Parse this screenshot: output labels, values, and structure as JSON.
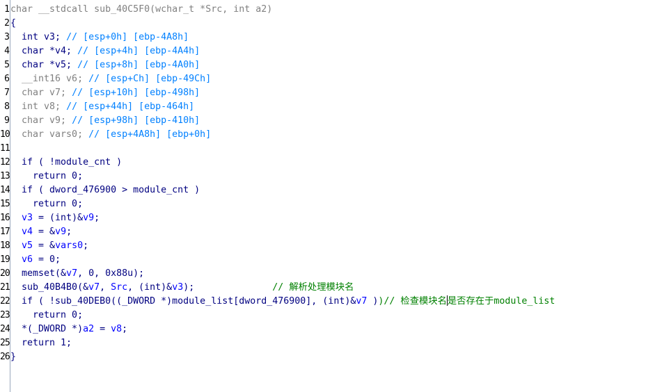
{
  "line_numbers": [
    "1",
    "2",
    "3",
    "4",
    "5",
    "6",
    "7",
    "8",
    "9",
    "10",
    "11",
    "12",
    "13",
    "14",
    "15",
    "16",
    "17",
    "18",
    "19",
    "20",
    "21",
    "22",
    "23",
    "24",
    "25",
    "26"
  ],
  "colors": {
    "background": "#ffffff",
    "gray_text": "#808080",
    "navy_text": "#000080",
    "blue_text": "#0000ff",
    "comment_text": "#0080ff",
    "green_comment": "#008000",
    "gutter_separator": "#9aa8bd"
  },
  "lines": [
    [
      {
        "t": "char __stdcall sub_40C5F0(wchar_t *Src, int a2)",
        "c": "gray"
      }
    ],
    [
      {
        "t": "{",
        "c": "navy"
      }
    ],
    [
      {
        "t": "  int v3; ",
        "c": "navy"
      },
      {
        "t": "// [esp+0h] [ebp-4A8h]",
        "c": "comment"
      }
    ],
    [
      {
        "t": "  char *v4; ",
        "c": "navy"
      },
      {
        "t": "// [esp+4h] [ebp-4A4h]",
        "c": "comment"
      }
    ],
    [
      {
        "t": "  char *v5; ",
        "c": "navy"
      },
      {
        "t": "// [esp+8h] [ebp-4A0h]",
        "c": "comment"
      }
    ],
    [
      {
        "t": "  __int16 v6; ",
        "c": "gray"
      },
      {
        "t": "// [esp+Ch] [ebp-49Ch]",
        "c": "comment"
      }
    ],
    [
      {
        "t": "  char v7; ",
        "c": "gray"
      },
      {
        "t": "// [esp+10h] [ebp-498h]",
        "c": "comment"
      }
    ],
    [
      {
        "t": "  int v8; ",
        "c": "gray"
      },
      {
        "t": "// [esp+44h] [ebp-464h]",
        "c": "comment"
      }
    ],
    [
      {
        "t": "  char v9; ",
        "c": "gray"
      },
      {
        "t": "// [esp+98h] [ebp-410h]",
        "c": "comment"
      }
    ],
    [
      {
        "t": "  char vars0; ",
        "c": "gray"
      },
      {
        "t": "// [esp+4A8h] [ebp+0h]",
        "c": "comment"
      }
    ],
    [
      {
        "t": "",
        "c": "navy"
      }
    ],
    [
      {
        "t": "  if ( !module_cnt )",
        "c": "navy"
      }
    ],
    [
      {
        "t": "    return 0;",
        "c": "navy"
      }
    ],
    [
      {
        "t": "  if ( dword_476900 > module_cnt )",
        "c": "navy"
      }
    ],
    [
      {
        "t": "    return 0;",
        "c": "navy"
      }
    ],
    [
      {
        "t": "  ",
        "c": "navy"
      },
      {
        "t": "v3",
        "c": "blue"
      },
      {
        "t": " = (int)&",
        "c": "navy"
      },
      {
        "t": "v9",
        "c": "blue"
      },
      {
        "t": ";",
        "c": "navy"
      }
    ],
    [
      {
        "t": "  ",
        "c": "navy"
      },
      {
        "t": "v4",
        "c": "blue"
      },
      {
        "t": " = &",
        "c": "navy"
      },
      {
        "t": "v9",
        "c": "blue"
      },
      {
        "t": ";",
        "c": "navy"
      }
    ],
    [
      {
        "t": "  ",
        "c": "navy"
      },
      {
        "t": "v5",
        "c": "blue"
      },
      {
        "t": " = &",
        "c": "navy"
      },
      {
        "t": "vars0",
        "c": "blue"
      },
      {
        "t": ";",
        "c": "navy"
      }
    ],
    [
      {
        "t": "  ",
        "c": "navy"
      },
      {
        "t": "v6",
        "c": "blue"
      },
      {
        "t": " = 0;",
        "c": "navy"
      }
    ],
    [
      {
        "t": "  memset(&",
        "c": "navy"
      },
      {
        "t": "v7",
        "c": "blue"
      },
      {
        "t": ", 0, 0x88u);",
        "c": "navy"
      }
    ],
    [
      {
        "t": "  sub_40B4B0(&",
        "c": "navy"
      },
      {
        "t": "v7",
        "c": "blue"
      },
      {
        "t": ", ",
        "c": "navy"
      },
      {
        "t": "Src",
        "c": "blue"
      },
      {
        "t": ", (int)&",
        "c": "navy"
      },
      {
        "t": "v3",
        "c": "blue"
      },
      {
        "t": ");              ",
        "c": "navy"
      },
      {
        "t": "// 解析处理模块名",
        "c": "green"
      }
    ],
    [
      {
        "t": "  if ( !sub_40DEB0((_DWORD *)module_list[dword_476900], (int)&",
        "c": "navy"
      },
      {
        "t": "v7",
        "c": "blue"
      },
      {
        "t": " )",
        "c": "navy"
      },
      {
        "t": ")// 检查模块名",
        "c": "green"
      },
      {
        "t": "",
        "c": "caret"
      },
      {
        "t": "是否存在于module_list",
        "c": "green"
      }
    ],
    [
      {
        "t": "    return 0;",
        "c": "navy"
      }
    ],
    [
      {
        "t": "  *(_DWORD *)",
        "c": "navy"
      },
      {
        "t": "a2",
        "c": "blue"
      },
      {
        "t": " = ",
        "c": "navy"
      },
      {
        "t": "v8",
        "c": "blue"
      },
      {
        "t": ";",
        "c": "navy"
      }
    ],
    [
      {
        "t": "  return 1;",
        "c": "navy"
      }
    ],
    [
      {
        "t": "}",
        "c": "navy"
      }
    ]
  ]
}
